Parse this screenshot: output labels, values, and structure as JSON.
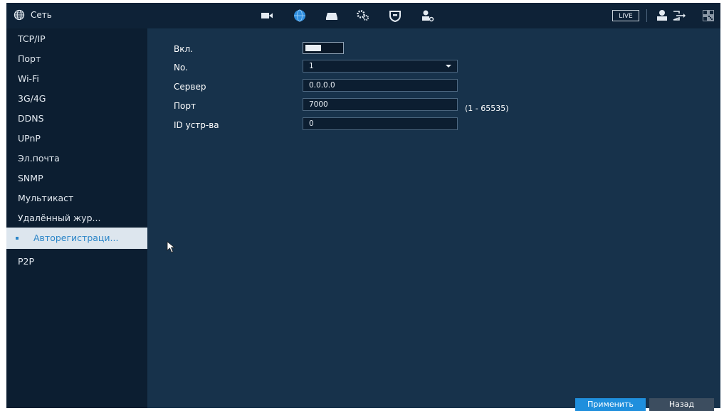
{
  "header": {
    "title": "Сеть",
    "live_label": "LIVE",
    "icons": [
      "camera-icon",
      "network-icon",
      "storage-icon",
      "settings-icon",
      "security-icon",
      "account-icon",
      "user-icon",
      "logout-icon",
      "qr-code-icon"
    ]
  },
  "sidebar": {
    "items": [
      {
        "label": "TCP/IP"
      },
      {
        "label": "Порт"
      },
      {
        "label": "Wi-Fi"
      },
      {
        "label": "3G/4G"
      },
      {
        "label": "DDNS"
      },
      {
        "label": "UPnP"
      },
      {
        "label": "Эл.почта"
      },
      {
        "label": "SNMP"
      },
      {
        "label": "Мультикаст"
      },
      {
        "label": "Удалённый жур..."
      },
      {
        "label": "Авторегистраци...",
        "active": true
      },
      {
        "label": "P2P"
      }
    ]
  },
  "form": {
    "enable_label": "Вкл.",
    "enable_value": true,
    "no_label": "No.",
    "no_value": "1",
    "server_label": "Сервер",
    "server_value": "0.0.0.0",
    "port_label": "Порт",
    "port_value": "7000",
    "port_range": "(1 - 65535)",
    "device_id_label": "ID устр-ва",
    "device_id_value": "0"
  },
  "footer": {
    "apply_label": "Применить",
    "back_label": "Назад"
  },
  "colors": {
    "background": "#17324b",
    "topbar": "#0e2237",
    "sidebar": "#0c1e31",
    "accent": "#1f8fdd",
    "active_item_bg": "#dde6ee"
  }
}
